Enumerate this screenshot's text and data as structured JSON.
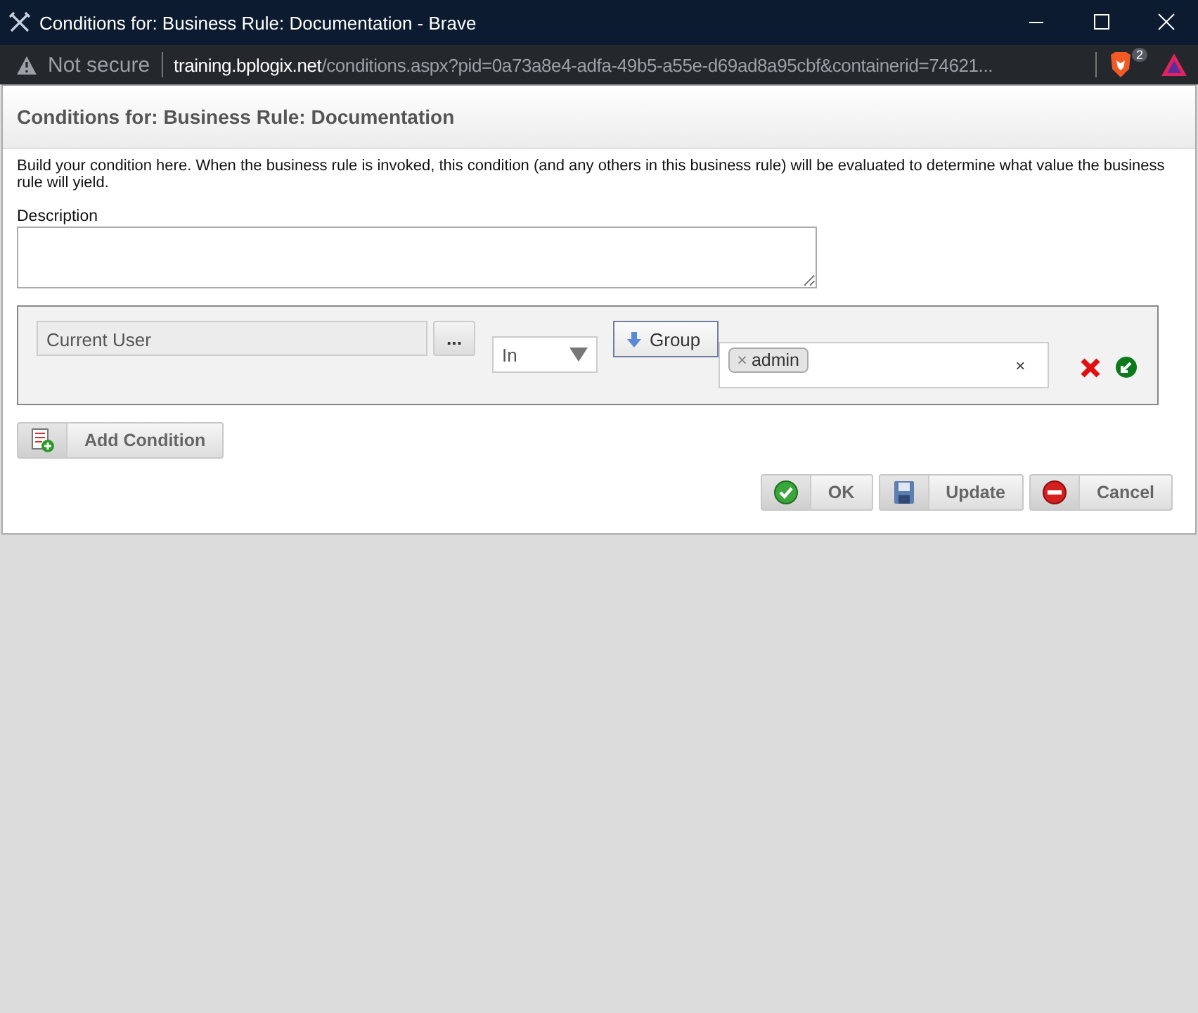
{
  "window": {
    "title": "Conditions for: Business Rule: Documentation - Brave"
  },
  "address_bar": {
    "security": "Not secure",
    "host": "training.bplogix.net",
    "path": "/conditions.aspx?pid=0a73a8e4-adfa-49b5-a55e-d69ad8a95cbf&containerid=74621...",
    "shields_count": "2"
  },
  "dialog": {
    "heading": "Conditions for: Business Rule: Documentation",
    "intro": "Build your condition here. When the business rule is invoked, this condition (and any others in this business rule) will be evaluated to determine what value the business rule will yield.",
    "description_label": "Description",
    "condition": {
      "field": "Current User",
      "browse": "...",
      "operator": "In",
      "type_button": "Group",
      "tags": [
        {
          "remove": "×",
          "label": "admin"
        }
      ],
      "clear": "×"
    },
    "add_button": {
      "kind": "add",
      "label": "Add Condition"
    },
    "buttons": [
      {
        "kind": "ok",
        "label": "OK"
      },
      {
        "kind": "update",
        "label": "Update"
      },
      {
        "kind": "cancel",
        "label": "Cancel"
      }
    ]
  }
}
